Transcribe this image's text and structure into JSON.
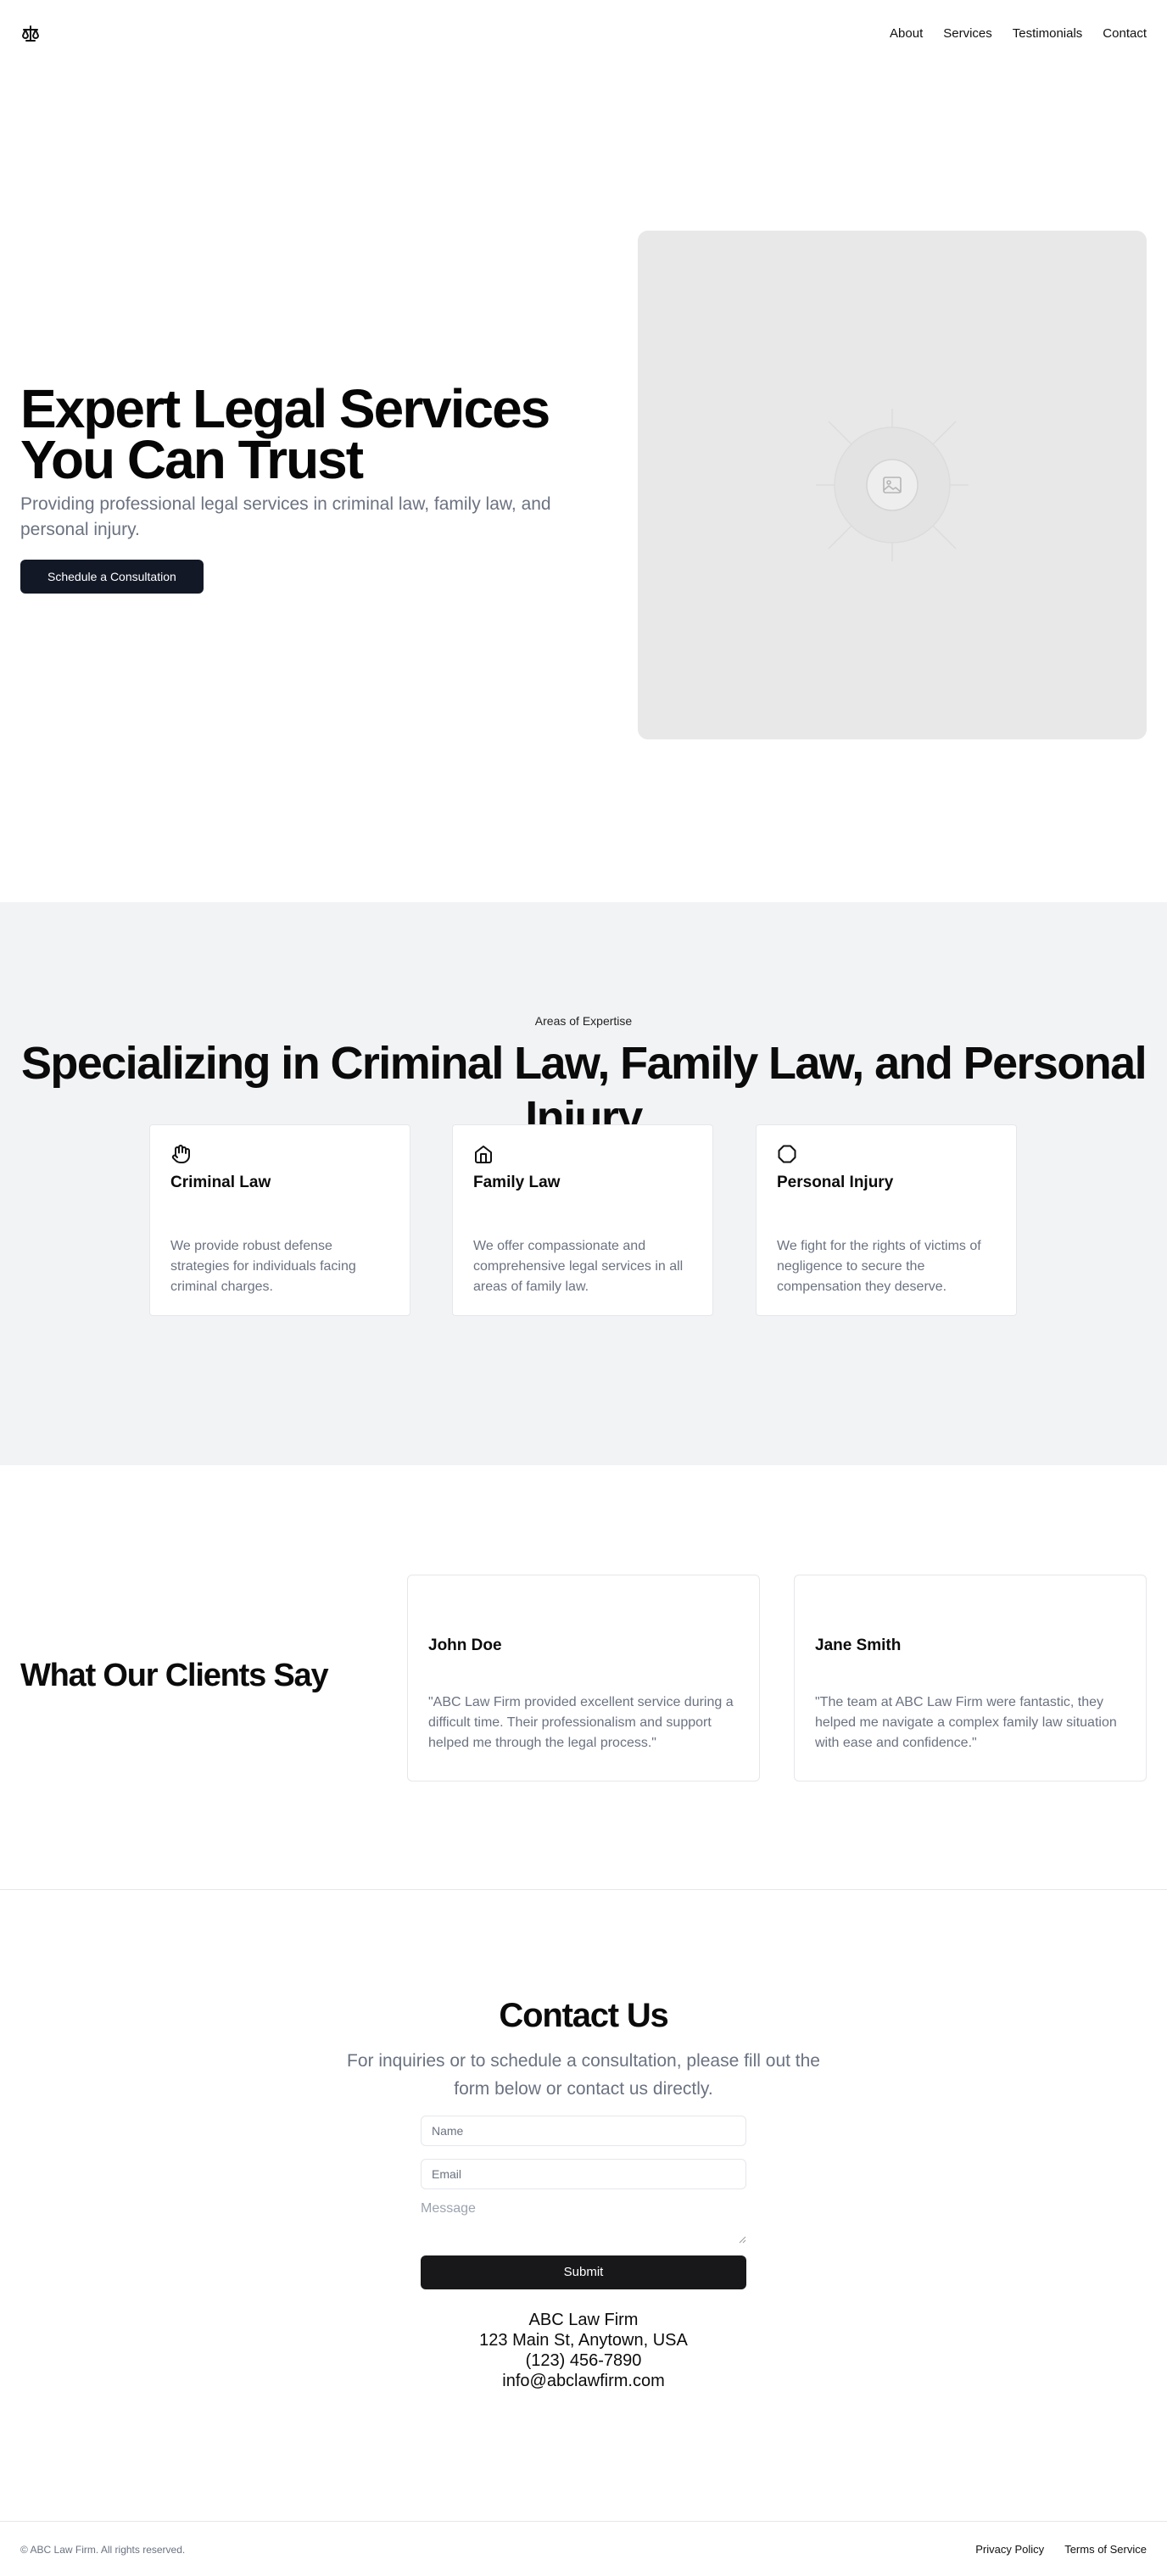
{
  "nav": {
    "items": [
      "About",
      "Services",
      "Testimonials",
      "Contact"
    ]
  },
  "hero": {
    "title_line1": "Expert Legal Services",
    "title_line2": "You Can Trust",
    "subtitle": "Providing professional legal services in criminal law, family law, and personal injury.",
    "cta": "Schedule a Consultation"
  },
  "expertise": {
    "eyebrow": "Areas of Expertise",
    "title": "Specializing in Criminal Law, Family Law, and Personal Injury",
    "cards": [
      {
        "icon": "hand-icon",
        "title": "Criminal Law",
        "desc": "We provide robust defense strategies for individuals facing criminal charges."
      },
      {
        "icon": "home-icon",
        "title": "Family Law",
        "desc": "We offer compassionate and comprehensive legal services in all areas of family law."
      },
      {
        "icon": "octagon-icon",
        "title": "Personal Injury",
        "desc": "We fight for the rights of victims of negligence to secure the compensation they deserve."
      }
    ]
  },
  "testimonials": {
    "title": "What Our Clients Say",
    "items": [
      {
        "name": "John Doe",
        "quote": "\"ABC Law Firm provided excellent service during a difficult time. Their professionalism and support helped me through the legal process.\""
      },
      {
        "name": "Jane Smith",
        "quote": "\"The team at ABC Law Firm were fantastic, they helped me navigate a complex family law situation with ease and confidence.\""
      }
    ]
  },
  "contact": {
    "title": "Contact Us",
    "subtitle": "For inquiries or to schedule a consultation, please fill out the form below or contact us directly.",
    "name_placeholder": "Name",
    "email_placeholder": "Email",
    "message_placeholder": "Message",
    "submit": "Submit",
    "firm": "ABC Law Firm",
    "address": "123 Main St, Anytown, USA",
    "phone": "(123) 456-7890",
    "email": "info@abclawfirm.com"
  },
  "footer": {
    "copyright": "© ABC Law Firm. All rights reserved.",
    "links": [
      "Privacy Policy",
      "Terms of Service"
    ]
  },
  "colors": {
    "primary_button": "#121826",
    "section_bg": "#f2f3f5",
    "muted_text": "#6b7280"
  }
}
